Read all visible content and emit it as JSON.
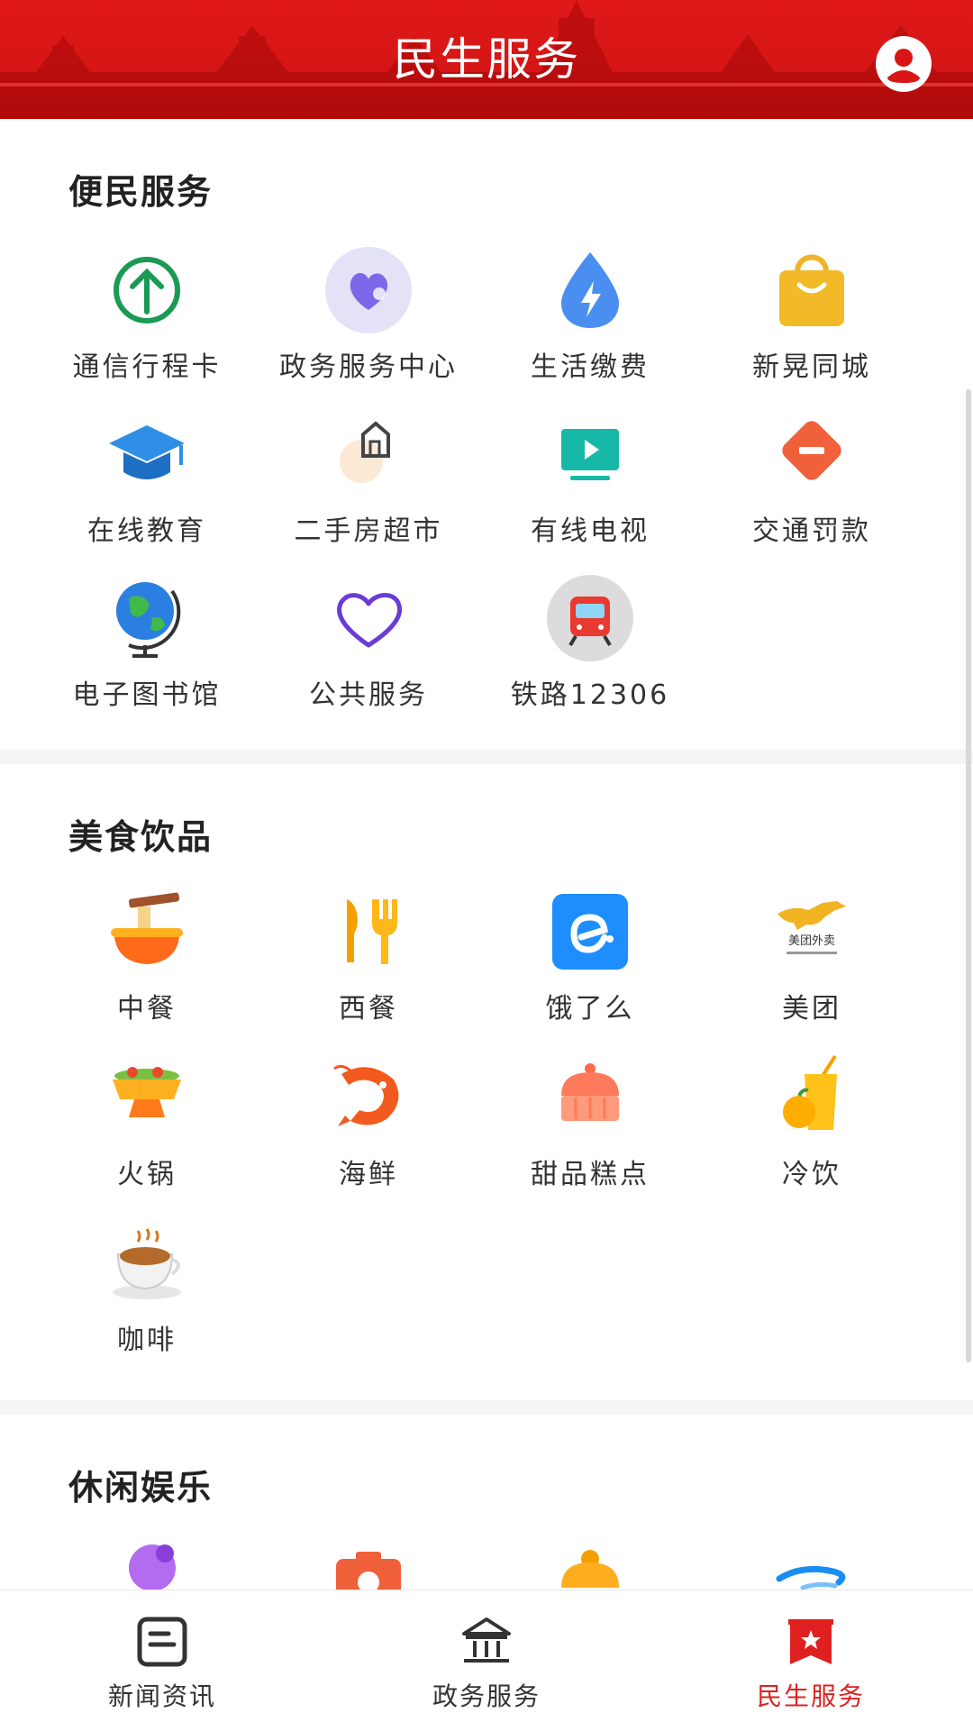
{
  "header": {
    "title": "民生服务",
    "theme_color": "#d91515"
  },
  "sections": [
    {
      "title": "便民服务",
      "items": [
        {
          "label": "通信行程卡",
          "icon": "travel-card-arrow-icon"
        },
        {
          "label": "政务服务中心",
          "icon": "government-heart-icon"
        },
        {
          "label": "生活缴费",
          "icon": "payment-drop-icon"
        },
        {
          "label": "新晃同城",
          "icon": "shopping-bag-icon"
        },
        {
          "label": "在线教育",
          "icon": "graduation-cap-icon"
        },
        {
          "label": "二手房超市",
          "icon": "house-icon"
        },
        {
          "label": "有线电视",
          "icon": "tv-icon"
        },
        {
          "label": "交通罚款",
          "icon": "no-entry-icon"
        },
        {
          "label": "电子图书馆",
          "icon": "globe-icon"
        },
        {
          "label": "公共服务",
          "icon": "heart-outline-icon"
        },
        {
          "label": "铁路12306",
          "icon": "train-icon"
        }
      ]
    },
    {
      "title": "美食饮品",
      "items": [
        {
          "label": "中餐",
          "icon": "noodle-bowl-icon"
        },
        {
          "label": "西餐",
          "icon": "fork-knife-icon"
        },
        {
          "label": "饿了么",
          "icon": "eleme-icon"
        },
        {
          "label": "美团",
          "icon": "meituan-kangaroo-icon",
          "logo_text": "美团外卖"
        },
        {
          "label": "火锅",
          "icon": "hotpot-icon"
        },
        {
          "label": "海鲜",
          "icon": "shrimp-icon"
        },
        {
          "label": "甜品糕点",
          "icon": "cake-icon"
        },
        {
          "label": "冷饮",
          "icon": "juice-icon"
        },
        {
          "label": "咖啡",
          "icon": "coffee-cup-icon"
        }
      ]
    },
    {
      "title": "休闲娱乐",
      "items": [
        {
          "label": "",
          "icon": "purple-character-icon"
        },
        {
          "label": "",
          "icon": "camera-icon"
        },
        {
          "label": "",
          "icon": "orange-bag-icon"
        },
        {
          "label": "",
          "icon": "blue-wave-icon"
        }
      ]
    }
  ],
  "tabbar": [
    {
      "label": "新闻资讯",
      "icon": "news-icon",
      "active": false
    },
    {
      "label": "政务服务",
      "icon": "government-building-icon",
      "active": false
    },
    {
      "label": "民生服务",
      "icon": "bookmark-star-icon",
      "active": true
    }
  ],
  "colors": {
    "active_tab": "#e02020",
    "accent_red": "#d91515"
  }
}
